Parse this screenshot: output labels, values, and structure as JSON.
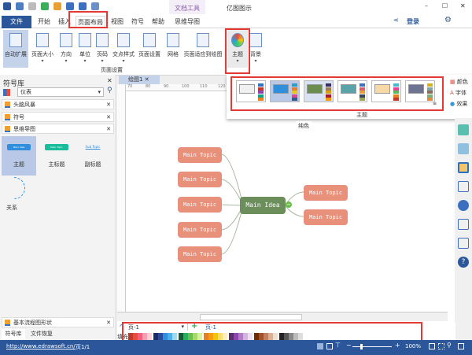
{
  "app": {
    "title": "亿图图示",
    "context_tab": "文档工具"
  },
  "tabs": [
    {
      "label": "文件"
    },
    {
      "label": "开始"
    },
    {
      "label": "插入"
    },
    {
      "label": "页面布局"
    },
    {
      "label": "视图"
    },
    {
      "label": "符号"
    },
    {
      "label": "帮助"
    },
    {
      "label": "思维导图"
    }
  ],
  "header_right": {
    "login": "登录"
  },
  "ribbon": {
    "page_setup": [
      {
        "label": "自动扩展"
      },
      {
        "label": "页面大小"
      },
      {
        "label": "方向"
      },
      {
        "label": "单位"
      },
      {
        "label": "页码"
      },
      {
        "label": "交点样式"
      },
      {
        "label": "页面设置"
      },
      {
        "label": "网格"
      },
      {
        "label": "页面适应到绘图"
      }
    ],
    "page_setup_group": "页面设置",
    "theme": "主题",
    "background": "背景"
  },
  "theme_gallery": {
    "label": "主题",
    "tooltip": "纯色",
    "side": [
      {
        "label": "颜色"
      },
      {
        "label": "字体"
      },
      {
        "label": "效果"
      }
    ],
    "themes": [
      {
        "main": "#f0f0f0",
        "stripes": [
          "#3b6fc0",
          "#c0392b",
          "#8e44ad",
          "#16a085",
          "#e67e22"
        ]
      },
      {
        "main": "#2f8fdc",
        "stripes": [
          "#27a0c8",
          "#e67e22",
          "#f1c40f",
          "#e84393",
          "#2c5d8f"
        ]
      },
      {
        "main": "#6b8e4e",
        "stripes": [
          "#3a2f5b",
          "#9c7b55",
          "#d4a017",
          "#a01c2c",
          "#f39c12"
        ]
      },
      {
        "main": "#5aa3a8",
        "stripes": [
          "#3b6fc0",
          "#e05a6d",
          "#e8a030",
          "#34495e",
          "#9aa84a"
        ]
      },
      {
        "main": "#f7d9a8",
        "stripes": [
          "#4cb7c9",
          "#e84393",
          "#5cb85c",
          "#e67e22",
          "#c0392b"
        ]
      },
      {
        "main": "#6e7391",
        "stripes": [
          "#d4b017",
          "#7fa6a8",
          "#8a6d5a",
          "#7bb07a",
          "#e08a3a"
        ]
      }
    ]
  },
  "library": {
    "title": "符号库",
    "search": "仪表",
    "sections": [
      {
        "label": "头脑风暴"
      },
      {
        "label": "符号"
      },
      {
        "label": "思维导图"
      }
    ],
    "shapes": [
      {
        "label": "主题",
        "preview": "Main Idea"
      },
      {
        "label": "主标题",
        "preview": "Main Topic"
      },
      {
        "label": "副标题",
        "preview": "Sub Topic"
      },
      {
        "label": "关系"
      }
    ],
    "bottom_section": "基本流程图形状",
    "bottom_tabs": [
      {
        "label": "符号库"
      },
      {
        "label": "文件恢复"
      }
    ]
  },
  "document": {
    "tab": "绘图1",
    "ruler": [
      "70",
      "80",
      "90",
      "100",
      "110",
      "120"
    ]
  },
  "mindmap": {
    "center": "Main Idea",
    "left": [
      "Main Topic",
      "Main Topic",
      "Main Topic",
      "Main Topic",
      "Main Topic"
    ],
    "right": [
      "Main Topic",
      "Main Topic"
    ]
  },
  "pages": {
    "selector": "页-1",
    "current": "页-1",
    "fill_label": "填充"
  },
  "status": {
    "url": "http://www.edrawsoft.cn/",
    "page": "页1/1",
    "zoom": "100%",
    "zoom_percent": 100
  },
  "colors": {
    "accent": "#2b579a",
    "topic": "#e8907a",
    "center": "#6b8e5a"
  }
}
